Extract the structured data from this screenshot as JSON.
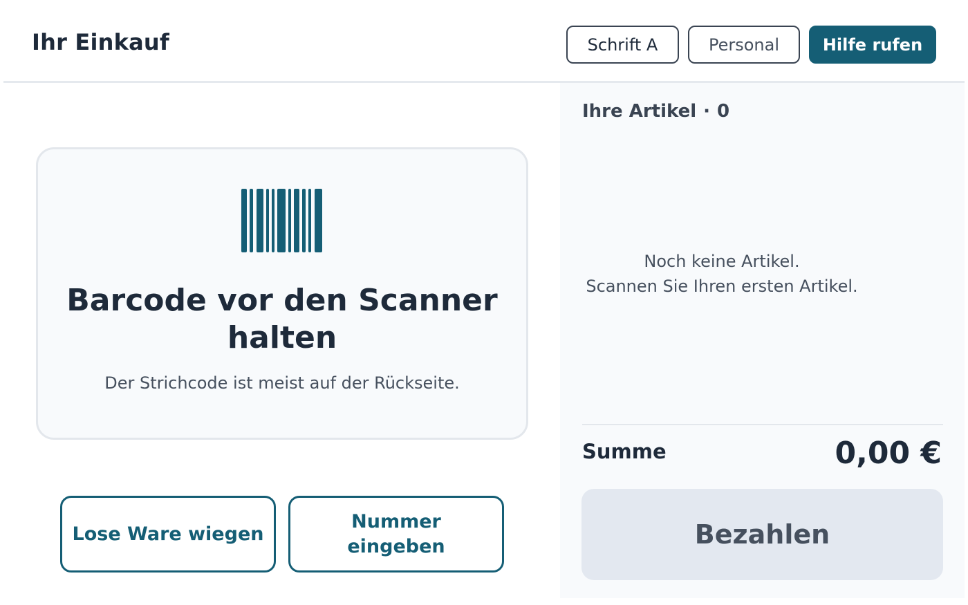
{
  "header": {
    "title": "Ihr Einkauf",
    "font_button": "Schrift A",
    "staff_button": "Personal",
    "help_button": "Hilfe rufen"
  },
  "scan": {
    "icon": "barcode-icon",
    "title_line1": "Barcode vor den Scanner",
    "title_line2": "halten",
    "hint": "Der Strichcode ist meist auf der Rückseite."
  },
  "actions": {
    "weigh_label": "Lose Ware wiegen",
    "number_line1": "Nummer",
    "number_line2": "eingeben"
  },
  "cart": {
    "heading": "Ihre Artikel",
    "separator": "·",
    "count": "0",
    "empty_line1": "Noch keine Artikel.",
    "empty_line2": "Scannen Sie Ihren ersten Artikel.",
    "sum_label": "Summe",
    "sum_value": "0,00 €",
    "pay_label": "Bezahlen"
  },
  "colors": {
    "accent": "#155e75",
    "text": "#1e2a3a",
    "panel": "#f8fafc",
    "pay_disabled": "#e3e8f0"
  }
}
